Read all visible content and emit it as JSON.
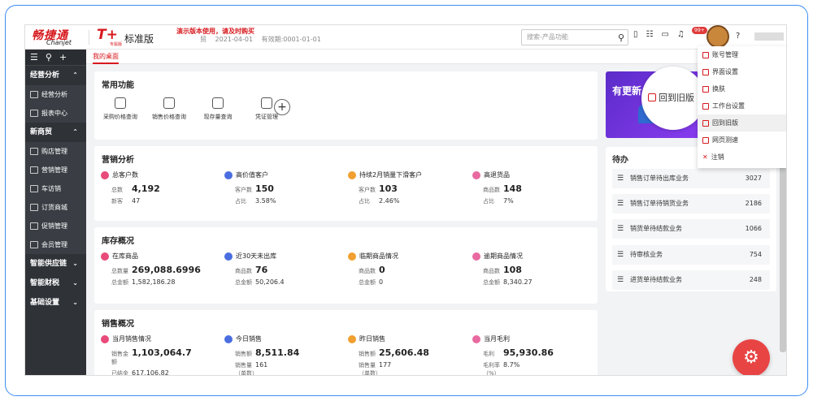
{
  "brand": {
    "name": "畅捷通",
    "sub": "Chanjet",
    "product": "T+",
    "product_sub": "专属版",
    "edition": "标准版"
  },
  "header": {
    "demo_notice": "演示版本使用，请及时购买",
    "trailing_char": "贸",
    "date": "2021-04-01",
    "expiry": "有效期:0001-01-01",
    "search_placeholder": "搜索-产品功能",
    "badge": "99+"
  },
  "sidebar": {
    "sections": [
      {
        "label": "经营分析",
        "items": [
          "经营分析",
          "报表中心"
        ]
      },
      {
        "label": "新商贸",
        "items": [
          "购店管理",
          "营销管理",
          "车访销",
          "订货商城",
          "促销管理",
          "会员管理"
        ]
      },
      {
        "label": "智能供应链",
        "items": []
      },
      {
        "label": "智能财税",
        "items": []
      },
      {
        "label": "基础设置",
        "items": []
      }
    ]
  },
  "tab": "我的桌面",
  "common": {
    "title": "常用功能",
    "funcs": [
      "采购价格查询",
      "销售价格查询",
      "现存量查询",
      "凭证管理"
    ],
    "add": "+"
  },
  "marketing": {
    "title": "营销分析",
    "metrics": [
      {
        "name": "总客户数",
        "color": "#e84a7a",
        "r1l": "总数",
        "r1v": "4,192",
        "r2l": "新客",
        "r2v": "47"
      },
      {
        "name": "高价值客户",
        "color": "#4a6ee0",
        "r1l": "客户数",
        "r1v": "150",
        "r2l": "占比",
        "r2v": "3.58%"
      },
      {
        "name": "持续2月销量下滑客户",
        "color": "#f0a030",
        "r1l": "客户数",
        "r1v": "103",
        "r2l": "占比",
        "r2v": "2.46%"
      },
      {
        "name": "高退货品",
        "color": "#e86aa0",
        "r1l": "商品数",
        "r1v": "148",
        "r2l": "占比",
        "r2v": "7%"
      }
    ]
  },
  "inventory": {
    "title": "库存概况",
    "metrics": [
      {
        "name": "在库商品",
        "color": "#e84a7a",
        "r1l": "总数量",
        "r1v": "269,088.6996",
        "r2l": "总金额",
        "r2v": "1,582,186.28"
      },
      {
        "name": "近30天未出库",
        "color": "#4a6ee0",
        "r1l": "商品数",
        "r1v": "76",
        "r2l": "总金额",
        "r2v": "50,206.4"
      },
      {
        "name": "临期商品情况",
        "color": "#f0a030",
        "r1l": "商品数",
        "r1v": "0",
        "r2l": "总金额",
        "r2v": "0"
      },
      {
        "name": "逾期商品情况",
        "color": "#e86aa0",
        "r1l": "商品数",
        "r1v": "108",
        "r2l": "总金额",
        "r2v": "8,340.27"
      }
    ]
  },
  "sales": {
    "title": "销售概况",
    "metrics": [
      {
        "name": "当月销售情况",
        "color": "#e84a7a",
        "r1l": "销售金额",
        "r1v": "1,103,064.7",
        "r2l": "已结金额",
        "r2v": "617,106.82"
      },
      {
        "name": "今日销售",
        "color": "#4a6ee0",
        "r1l": "销售额",
        "r1v": "8,511.84",
        "r2l": "销售量（单数）",
        "r2v": "161"
      },
      {
        "name": "昨日销售",
        "color": "#f0a030",
        "r1l": "销售额",
        "r1v": "25,606.48",
        "r2l": "销售量（单数）",
        "r2v": "177"
      },
      {
        "name": "当月毛利",
        "color": "#e86aa0",
        "r1l": "毛利",
        "r1v": "95,930.86",
        "r2l": "毛利率（%）",
        "r2v": "8.7%"
      }
    ]
  },
  "banner": {
    "text": "有更新",
    "bubble": "回到旧版"
  },
  "todo": {
    "title": "待办",
    "items": [
      {
        "label": "销售订单待出库业务",
        "count": "3027"
      },
      {
        "label": "销售订单待销货业务",
        "count": "2186"
      },
      {
        "label": "销货单待结款业务",
        "count": "1066"
      },
      {
        "label": "待审核业务",
        "count": "754"
      },
      {
        "label": "进货单待结款业务",
        "count": "248"
      }
    ]
  },
  "user_menu": [
    "账号管理",
    "界面设置",
    "换肤",
    "工作台设置",
    "回到旧版",
    "网页测速",
    "注销"
  ]
}
